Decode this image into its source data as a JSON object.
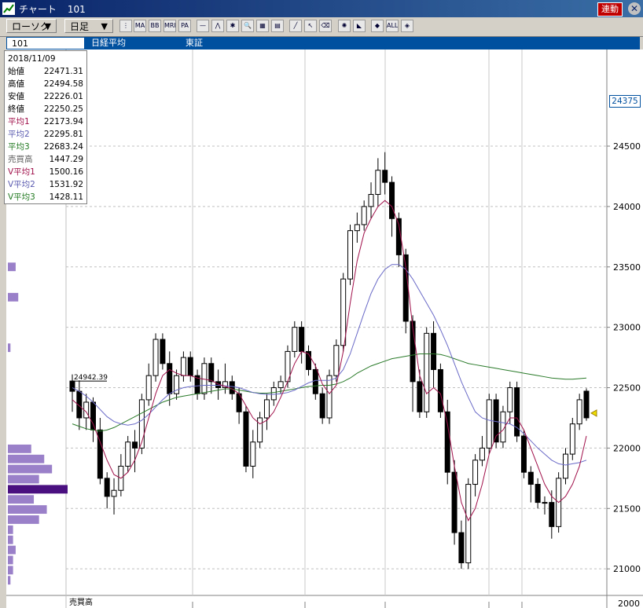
{
  "window": {
    "app_title": "チャート",
    "code": "101",
    "link_label": "連動"
  },
  "toolbar": {
    "chart_type": "ローソク",
    "period": "日足",
    "tools": [
      {
        "label": "⋮",
        "icon": "indicator-select-icon"
      },
      {
        "label": "MA",
        "icon": "ma-icon"
      },
      {
        "label": "BB",
        "icon": "bb-icon"
      },
      {
        "label": "MRE",
        "icon": "mre-icon"
      },
      {
        "label": "PA",
        "icon": "pa-icon"
      },
      {
        "label": "—",
        "icon": "trendline-icon"
      },
      {
        "label": "⋀",
        "icon": "wave-icon"
      },
      {
        "label": "✱",
        "icon": "star-icon"
      },
      {
        "label": "🔍",
        "icon": "zoom-icon"
      },
      {
        "label": "▦",
        "icon": "grid-icon"
      },
      {
        "label": "▤",
        "icon": "table-icon"
      },
      {
        "label": "╱",
        "icon": "pen-icon"
      },
      {
        "label": "↖",
        "icon": "cursor-icon"
      },
      {
        "label": "⌫",
        "icon": "eraser-icon"
      },
      {
        "label": "✺",
        "icon": "settings-icon"
      },
      {
        "label": "◣",
        "icon": "fibonacci-icon"
      },
      {
        "label": "◆",
        "icon": "crosshair-icon"
      },
      {
        "label": "ALL",
        "icon": "all-icon"
      },
      {
        "label": "◈",
        "icon": "dot-icon"
      }
    ]
  },
  "info_bar": {
    "code": "101",
    "name": "日経平均",
    "market": "東証"
  },
  "info_box": {
    "date": "2018/11/09",
    "rows": [
      {
        "label": "始値",
        "value": "22471.31",
        "color": "#000000"
      },
      {
        "label": "高値",
        "value": "22494.58",
        "color": "#000000"
      },
      {
        "label": "安値",
        "value": "22226.01",
        "color": "#000000"
      },
      {
        "label": "終値",
        "value": "22250.25",
        "color": "#000000"
      },
      {
        "label": "平均1",
        "value": "22173.94",
        "color": "#a0104a"
      },
      {
        "label": "平均2",
        "value": "22295.81",
        "color": "#5a5ab0"
      },
      {
        "label": "平均3",
        "value": "22683.24",
        "color": "#207820"
      },
      {
        "label": "売買高",
        "value": "1447.29",
        "color": "#606060"
      },
      {
        "label": "V平均1",
        "value": "1500.16",
        "color": "#a0104a"
      },
      {
        "label": "V平均2",
        "value": "1531.92",
        "color": "#5a5ab0"
      },
      {
        "label": "V平均3",
        "value": "1428.11",
        "color": "#207820"
      }
    ]
  },
  "current_price_label": "24375",
  "max_label": "24942.39",
  "volume_label": "売買高",
  "volume_axis_label": "2000",
  "colors": {
    "ma1": "#a0104a",
    "ma2": "#6a6ac8",
    "ma3": "#2a7a2a",
    "profile": "#9a80c8",
    "profile_peak": "#4a1080"
  },
  "chart_data": {
    "type": "candlestick",
    "ylim": [
      20780,
      25300
    ],
    "yticks": [
      21000,
      21500,
      22000,
      22500,
      23000,
      23500,
      24000,
      24500
    ],
    "candles": [
      [
        22555,
        22470,
        22610,
        22300
      ],
      [
        22470,
        22250,
        22560,
        22150
      ],
      [
        22250,
        22380,
        22450,
        22150
      ],
      [
        22380,
        22150,
        22420,
        22050
      ],
      [
        22150,
        21750,
        22250,
        21700
      ],
      [
        21750,
        21600,
        21800,
        21500
      ],
      [
        21600,
        21650,
        21750,
        21450
      ],
      [
        21650,
        21850,
        21950,
        21600
      ],
      [
        21850,
        22050,
        22100,
        21800
      ],
      [
        22050,
        22000,
        22150,
        21800
      ],
      [
        22000,
        22400,
        22450,
        21950
      ],
      [
        22400,
        22600,
        22700,
        22350
      ],
      [
        22600,
        22900,
        22950,
        22550
      ],
      [
        22900,
        22700,
        22950,
        22650
      ],
      [
        22700,
        22450,
        22800,
        22350
      ],
      [
        22450,
        22600,
        22650,
        22400
      ],
      [
        22600,
        22750,
        22800,
        22550
      ],
      [
        22750,
        22600,
        22800,
        22550
      ],
      [
        22600,
        22450,
        22650,
        22400
      ],
      [
        22450,
        22700,
        22750,
        22400
      ],
      [
        22700,
        22550,
        22750,
        22450
      ],
      [
        22550,
        22500,
        22650,
        22400
      ],
      [
        22500,
        22550,
        22700,
        22450
      ],
      [
        22550,
        22450,
        22600,
        22400
      ],
      [
        22450,
        22300,
        22500,
        22200
      ],
      [
        22300,
        21850,
        22350,
        21800
      ],
      [
        21850,
        22050,
        22150,
        21750
      ],
      [
        22050,
        22250,
        22300,
        22000
      ],
      [
        22250,
        22400,
        22450,
        22150
      ],
      [
        22400,
        22500,
        22550,
        22350
      ],
      [
        22500,
        22550,
        22600,
        22450
      ],
      [
        22550,
        22800,
        22850,
        22500
      ],
      [
        22800,
        23000,
        23050,
        22750
      ],
      [
        23000,
        22800,
        23050,
        22700
      ],
      [
        22800,
        22650,
        22850,
        22600
      ],
      [
        22650,
        22450,
        22700,
        22400
      ],
      [
        22450,
        22250,
        22500,
        22200
      ],
      [
        22250,
        22600,
        22650,
        22200
      ],
      [
        22600,
        22850,
        22900,
        22550
      ],
      [
        22850,
        23400,
        23450,
        22800
      ],
      [
        23400,
        23800,
        23850,
        23350
      ],
      [
        23800,
        23850,
        23950,
        23700
      ],
      [
        23850,
        24000,
        24050,
        23800
      ],
      [
        24000,
        24100,
        24200,
        23900
      ],
      [
        24100,
        24300,
        24400,
        24000
      ],
      [
        24300,
        24200,
        24450,
        24100
      ],
      [
        24200,
        23900,
        24250,
        23750
      ],
      [
        23900,
        23600,
        23950,
        23500
      ],
      [
        23600,
        23050,
        23650,
        22950
      ],
      [
        23050,
        22550,
        23100,
        22300
      ],
      [
        22550,
        22300,
        22650,
        22250
      ],
      [
        22300,
        22950,
        23000,
        22250
      ],
      [
        22950,
        22650,
        23050,
        22500
      ],
      [
        22650,
        22300,
        22700,
        22250
      ],
      [
        22300,
        21800,
        22400,
        21700
      ],
      [
        21800,
        21300,
        21900,
        21200
      ],
      [
        21300,
        21050,
        21400,
        21000
      ],
      [
        21050,
        21700,
        21750,
        21000
      ],
      [
        21700,
        21900,
        21950,
        21600
      ],
      [
        21900,
        22000,
        22100,
        21850
      ],
      [
        22000,
        22400,
        22450,
        21950
      ],
      [
        22400,
        22050,
        22450,
        22000
      ],
      [
        22050,
        22300,
        22350,
        22000
      ],
      [
        22300,
        22500,
        22550,
        22200
      ],
      [
        22500,
        22100,
        22550,
        22050
      ],
      [
        22100,
        21800,
        22150,
        21750
      ],
      [
        21800,
        21700,
        21850,
        21550
      ],
      [
        21700,
        21550,
        21750,
        21500
      ],
      [
        21550,
        21550,
        21600,
        21450
      ],
      [
        21550,
        21350,
        21650,
        21250
      ],
      [
        21350,
        21750,
        21800,
        21300
      ],
      [
        21750,
        21950,
        22000,
        21700
      ],
      [
        21950,
        22200,
        22250,
        21900
      ],
      [
        22200,
        22400,
        22450,
        22150
      ],
      [
        22471.31,
        22250.25,
        22494.58,
        22226.01
      ]
    ],
    "ma1": [
      22400,
      22350,
      22300,
      22200,
      22050,
      21900,
      21780,
      21750,
      21800,
      21900,
      22050,
      22250,
      22450,
      22600,
      22650,
      22620,
      22600,
      22600,
      22580,
      22570,
      22560,
      22530,
      22510,
      22490,
      22450,
      22350,
      22250,
      22200,
      22230,
      22300,
      22420,
      22550,
      22700,
      22800,
      22780,
      22680,
      22530,
      22450,
      22520,
      22800,
      23200,
      23550,
      23780,
      23900,
      24000,
      24050,
      24000,
      23850,
      23500,
      23000,
      22600,
      22450,
      22500,
      22450,
      22200,
      21850,
      21550,
      21400,
      21500,
      21700,
      21950,
      22100,
      22150,
      22250,
      22250,
      22150,
      22000,
      21850,
      21700,
      21600,
      21550,
      21600,
      21700,
      21850,
      22100
    ],
    "ma2": [
      22500,
      22470,
      22430,
      22380,
      22320,
      22260,
      22220,
      22200,
      22190,
      22200,
      22230,
      22280,
      22340,
      22400,
      22450,
      22480,
      22500,
      22510,
      22515,
      22520,
      22520,
      22520,
      22515,
      22510,
      22500,
      22480,
      22460,
      22450,
      22445,
      22445,
      22450,
      22460,
      22480,
      22510,
      22540,
      22560,
      22560,
      22560,
      22580,
      22650,
      22780,
      22950,
      23120,
      23280,
      23400,
      23480,
      23520,
      23520,
      23480,
      23400,
      23300,
      23200,
      23100,
      22980,
      22850,
      22700,
      22550,
      22420,
      22300,
      22250,
      22230,
      22220,
      22210,
      22200,
      22170,
      22120,
      22060,
      22000,
      21950,
      21900,
      21870,
      21860,
      21870,
      21880,
      21900
    ],
    "ma3": [
      22200,
      22180,
      22160,
      22150,
      22140,
      22150,
      22170,
      22200,
      22230,
      22260,
      22290,
      22320,
      22350,
      22380,
      22400,
      22420,
      22430,
      22440,
      22450,
      22460,
      22470,
      22480,
      22490,
      22490,
      22480,
      22470,
      22460,
      22455,
      22455,
      22460,
      22470,
      22480,
      22490,
      22500,
      22510,
      22515,
      22520,
      22520,
      22530,
      22550,
      22580,
      22620,
      22650,
      22680,
      22700,
      22720,
      22740,
      22750,
      22760,
      22770,
      22780,
      22780,
      22780,
      22775,
      22760,
      22740,
      22720,
      22700,
      22690,
      22680,
      22670,
      22660,
      22650,
      22640,
      22630,
      22620,
      22610,
      22600,
      22590,
      22580,
      22575,
      22570,
      22570,
      22575,
      22580
    ],
    "volume_profile": [
      0,
      0,
      0,
      0,
      0,
      0,
      0,
      0,
      0,
      0,
      0,
      0,
      0,
      0,
      0,
      0,
      0,
      0,
      0,
      0,
      0,
      3,
      0,
      0,
      4,
      0,
      0,
      0,
      0,
      1,
      0,
      0,
      0,
      0,
      0,
      0,
      0,
      0,
      0,
      9,
      14,
      17,
      12,
      23,
      10,
      15,
      12,
      2,
      2,
      3,
      2,
      2,
      1,
      0
    ]
  }
}
